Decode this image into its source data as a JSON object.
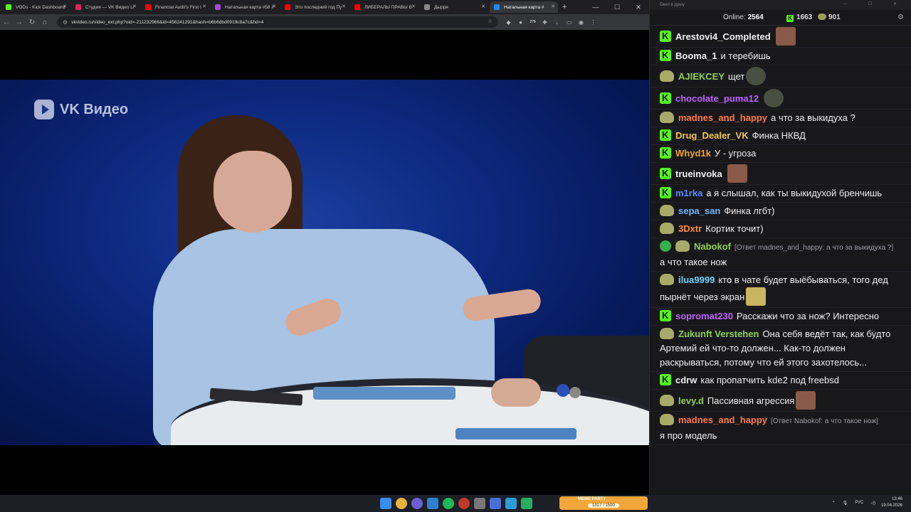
{
  "browser": {
    "tabs": [
      {
        "label": "VODs - Kick Dashboard",
        "fav": "#53fc18"
      },
      {
        "label": "Студия — VK Видео Li",
        "fav": "#e0245e"
      },
      {
        "label": "Financial Audit's First I",
        "fav": "#ff0000"
      },
      {
        "label": "Натальная карта #58 //",
        "fav": "#a04bd6"
      },
      {
        "label": "Это последний год Пу",
        "fav": "#ff0000"
      },
      {
        "label": "ЛИБЕРАЛЫ ПРАВЫ В",
        "fav": "#ff0000"
      },
      {
        "label": "Дырря",
        "fav": "#888888"
      },
      {
        "label": "Натальная карта #",
        "fav": "#2787f5",
        "active": true
      }
    ],
    "url": "vkvideo.ru/video_ext.php?oid=-211232966&id=456241291&hash=b6b6dbd0919c8a7c&hd=4",
    "ext_badge": "279",
    "video_logo": "VK Видео"
  },
  "chat": {
    "window_title": "Окно в душу",
    "online_label": "Online:",
    "online_count": "2564",
    "count_kick": "1663",
    "count_frog": "901",
    "messages": [
      {
        "badge": "kick",
        "user": "Arestovi4_Completed",
        "color": "#f0f0f0",
        "text": "",
        "emote": "face1"
      },
      {
        "badge": "kick",
        "user": "Booma_1",
        "color": "#f0f0f0",
        "text": "и теребишь"
      },
      {
        "badge": "frog",
        "user": "AJIEKCEY",
        "color": "#8fd14f",
        "text": "щет",
        "emote": "dog"
      },
      {
        "badge": "kick",
        "user": "chocolate_puma12",
        "color": "#c061ff",
        "text": "",
        "emote": "dog"
      },
      {
        "badge": "frog",
        "user": "madnes_and_happy",
        "color": "#ff7a45",
        "text": "а что за выкидуха ?"
      },
      {
        "badge": "kick",
        "user": "Drug_Dealer_VK",
        "color": "#f5c84c",
        "text": "Финка НКВД"
      },
      {
        "badge": "kick",
        "user": "Whyd1k",
        "color": "#f5a623",
        "text": "У - угроза"
      },
      {
        "badge": "kick",
        "user": "trueinvoka",
        "color": "#f0f0f0",
        "text": "",
        "emote": "face1"
      },
      {
        "badge": "kick",
        "user": "m1rka",
        "color": "#5b8cff",
        "text": "а я слышал, как ты выкидухой бренчишь"
      },
      {
        "badge": "frog",
        "user": "sepa_san",
        "color": "#6fb7ff",
        "text": "Финка лгбт)"
      },
      {
        "badge": "frog",
        "user": "3Dxtr",
        "color": "#ff8c3a",
        "text": "Кортик точит)"
      },
      {
        "badge": "check",
        "user": "Nabokof",
        "color": "#8fd14f",
        "reply": "[Ответ madnes_and_happy: а что за выкидуха ?]",
        "text": "а что такое нож"
      },
      {
        "badge": "frog",
        "user": "ilua9999",
        "color": "#6fd3ff",
        "text": "кто в чате будет выёбываться, того дед пырнёт через экран",
        "emote": "hapy"
      },
      {
        "badge": "kick",
        "user": "sopromat230",
        "color": "#c061ff",
        "text": "Расскажи что за нож? Интересно"
      },
      {
        "badge": "frog",
        "user": "Zukunft Verstehen",
        "color": "#8fd14f",
        "text": "Она себя ведёт так, как будто Артемий ей что-то должен... Как-то должен раскрываться, потому что ей этого захотелось..."
      },
      {
        "badge": "kick",
        "user": "cdrw",
        "color": "#f0f0f0",
        "text": "как пропатчить kde2 под freebsd"
      },
      {
        "badge": "frog",
        "user": "levy.d",
        "color": "#8fd14f",
        "text": "Пассивная агрессия",
        "emote": "face1"
      },
      {
        "badge": "frog",
        "user": "madnes_and_happy",
        "color": "#ff7a45",
        "reply": "[Ответ Nabokof: а что такое нож]",
        "text": "я про модель"
      }
    ]
  },
  "taskbar": {
    "meme_title": "MEME PARTY",
    "meme_value": "1317 / 1500",
    "lang": "РУС",
    "time": "13:46",
    "date": "19.04.2026"
  }
}
